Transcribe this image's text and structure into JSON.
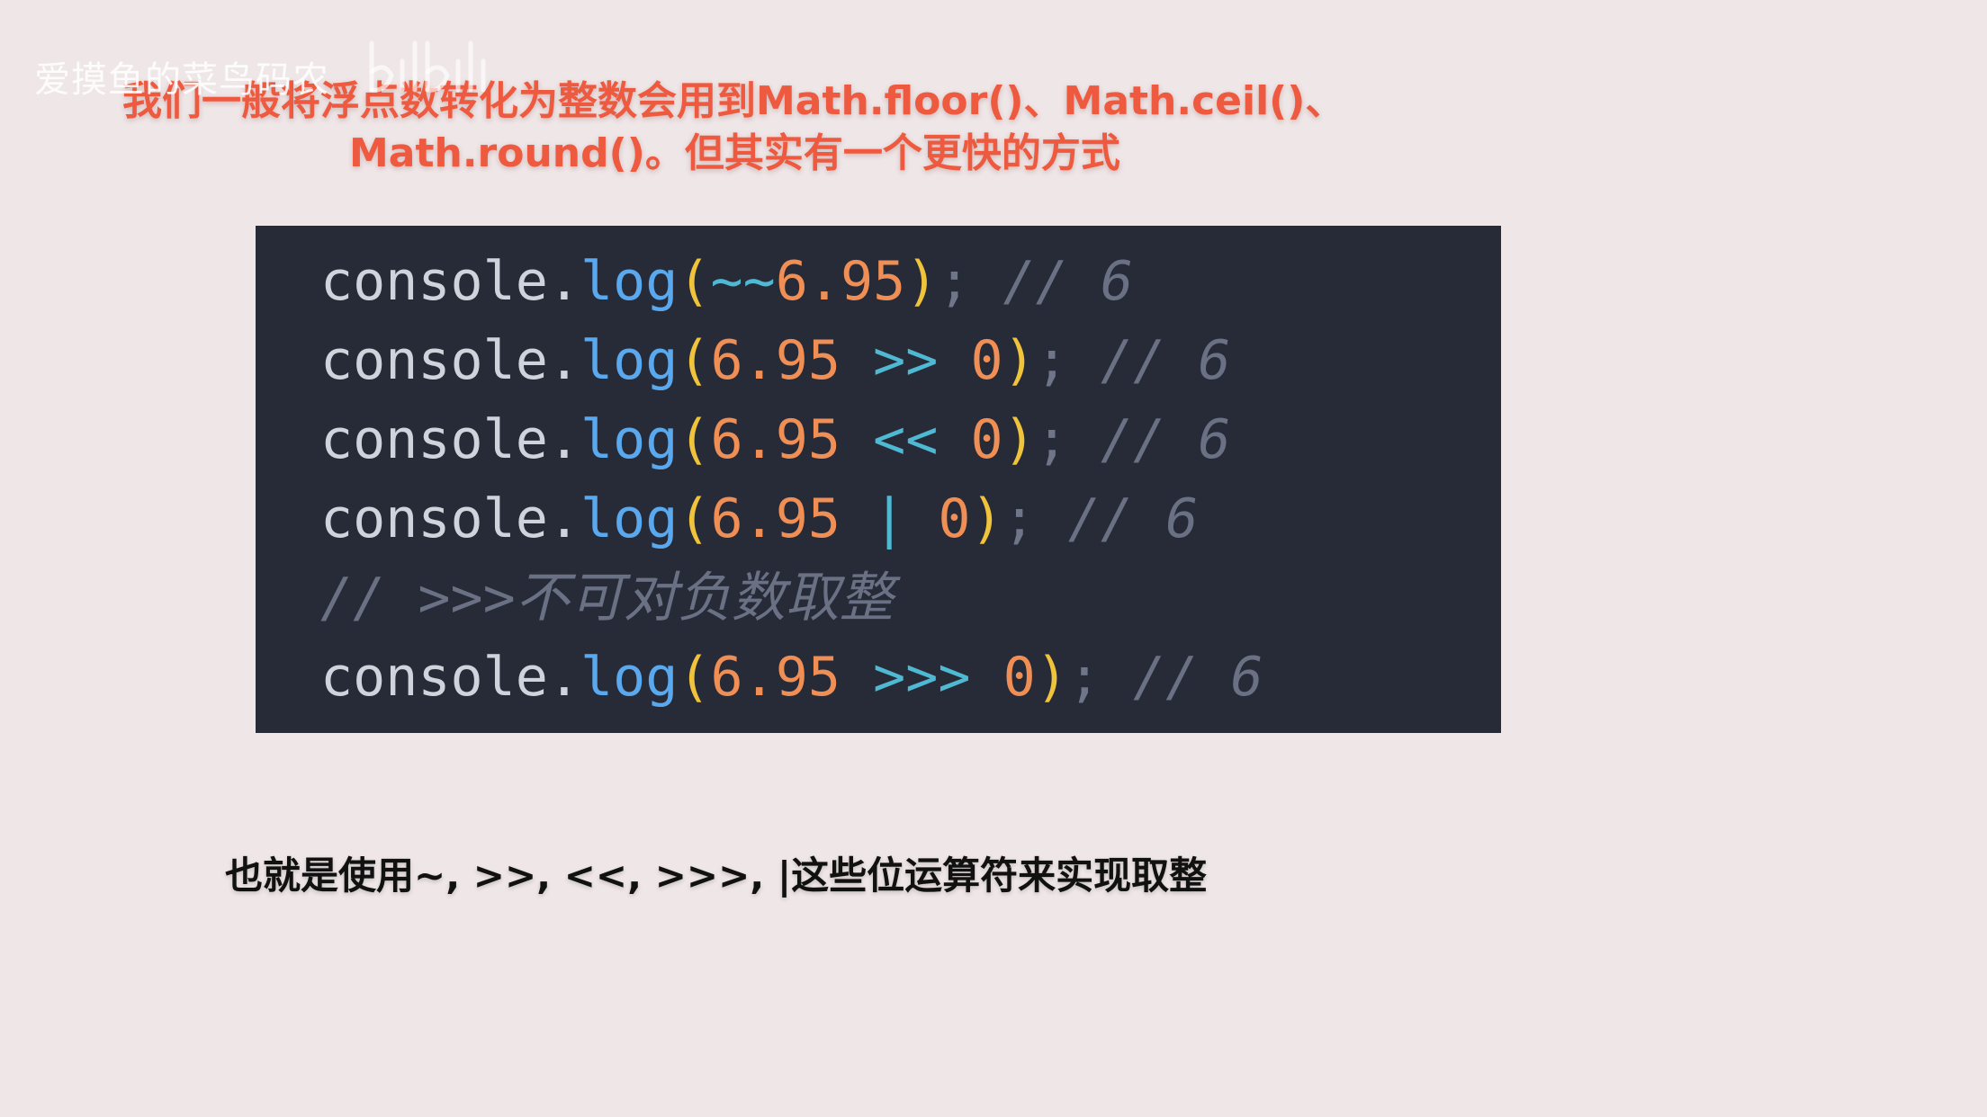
{
  "watermark": {
    "text": "爱摸鱼的菜鸟码农",
    "logo_icon": "bilibili-logo-icon"
  },
  "title": {
    "line1": "我们一般将浮点数转化为整数会用到Math.floor()、Math.ceil()、",
    "line2": "Math.round()。但其实有一个更快的方式"
  },
  "code": {
    "lines": [
      {
        "tokens": [
          {
            "text": "console",
            "type": "obj"
          },
          {
            "text": ".",
            "type": "obj"
          },
          {
            "text": "log",
            "type": "fn"
          },
          {
            "text": "(",
            "type": "paren"
          },
          {
            "text": "~~",
            "type": "op"
          },
          {
            "text": "6.95",
            "type": "num"
          },
          {
            "text": ")",
            "type": "paren"
          },
          {
            "text": "; ",
            "type": "semi"
          },
          {
            "text": "// 6",
            "type": "cmt"
          }
        ]
      },
      {
        "tokens": [
          {
            "text": "console",
            "type": "obj"
          },
          {
            "text": ".",
            "type": "obj"
          },
          {
            "text": "log",
            "type": "fn"
          },
          {
            "text": "(",
            "type": "paren"
          },
          {
            "text": "6.95",
            "type": "num"
          },
          {
            "text": " >> ",
            "type": "op"
          },
          {
            "text": "0",
            "type": "num"
          },
          {
            "text": ")",
            "type": "paren"
          },
          {
            "text": "; ",
            "type": "semi"
          },
          {
            "text": "// 6",
            "type": "cmt"
          }
        ]
      },
      {
        "tokens": [
          {
            "text": "console",
            "type": "obj"
          },
          {
            "text": ".",
            "type": "obj"
          },
          {
            "text": "log",
            "type": "fn"
          },
          {
            "text": "(",
            "type": "paren"
          },
          {
            "text": "6.95",
            "type": "num"
          },
          {
            "text": " << ",
            "type": "op"
          },
          {
            "text": "0",
            "type": "num"
          },
          {
            "text": ")",
            "type": "paren"
          },
          {
            "text": "; ",
            "type": "semi"
          },
          {
            "text": "// 6",
            "type": "cmt"
          }
        ]
      },
      {
        "tokens": [
          {
            "text": "console",
            "type": "obj"
          },
          {
            "text": ".",
            "type": "obj"
          },
          {
            "text": "log",
            "type": "fn"
          },
          {
            "text": "(",
            "type": "paren"
          },
          {
            "text": "6.95",
            "type": "num"
          },
          {
            "text": " | ",
            "type": "op"
          },
          {
            "text": "0",
            "type": "num"
          },
          {
            "text": ")",
            "type": "paren"
          },
          {
            "text": "; ",
            "type": "semi"
          },
          {
            "text": "// 6",
            "type": "cmt"
          }
        ]
      },
      {
        "tokens": [
          {
            "text": "// >>>",
            "type": "cmt"
          },
          {
            "text": "不可对负数取整",
            "type": "cmt-zh"
          }
        ]
      },
      {
        "tokens": [
          {
            "text": "console",
            "type": "obj"
          },
          {
            "text": ".",
            "type": "obj"
          },
          {
            "text": "log",
            "type": "fn"
          },
          {
            "text": "(",
            "type": "paren"
          },
          {
            "text": "6.95",
            "type": "num"
          },
          {
            "text": " >>> ",
            "type": "op"
          },
          {
            "text": "0",
            "type": "num"
          },
          {
            "text": ")",
            "type": "paren"
          },
          {
            "text": "; ",
            "type": "semi"
          },
          {
            "text": "// 6",
            "type": "cmt"
          }
        ]
      }
    ]
  },
  "bottom": {
    "text": "也就是使用~, >>, <<, >>>, |这些位运算符来实现取整"
  },
  "colors": {
    "background": "#efe6e7",
    "title": "#ee5a3f",
    "code_bg": "#272b37",
    "identifier": "#cfd3dc",
    "function": "#5aa9ee",
    "paren": "#f0c33c",
    "number": "#ef8f56",
    "operator": "#4fb9d3",
    "comment": "#6a7184"
  }
}
